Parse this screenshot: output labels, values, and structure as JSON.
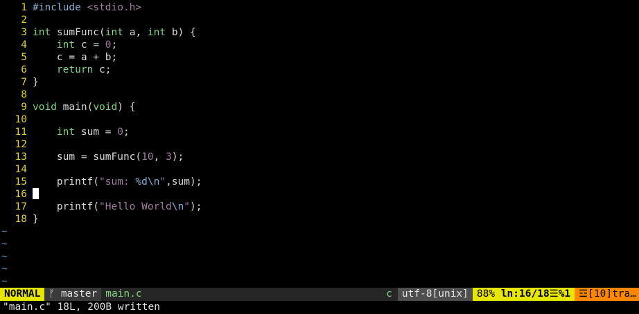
{
  "editor": {
    "lines": [
      {
        "num": "1",
        "tokens": [
          [
            "pre",
            "#include "
          ],
          [
            "str",
            "<stdio.h>"
          ]
        ]
      },
      {
        "num": "2",
        "tokens": []
      },
      {
        "num": "3",
        "tokens": [
          [
            "type",
            "int"
          ],
          [
            "plain",
            " sumFunc("
          ],
          [
            "type",
            "int"
          ],
          [
            "plain",
            " a, "
          ],
          [
            "type",
            "int"
          ],
          [
            "plain",
            " b) {"
          ]
        ]
      },
      {
        "num": "4",
        "tokens": [
          [
            "plain",
            "    "
          ],
          [
            "type",
            "int"
          ],
          [
            "plain",
            " c = "
          ],
          [
            "num",
            "0"
          ],
          [
            "plain",
            ";"
          ]
        ]
      },
      {
        "num": "5",
        "tokens": [
          [
            "plain",
            "    c = a + b;"
          ]
        ]
      },
      {
        "num": "6",
        "tokens": [
          [
            "plain",
            "    "
          ],
          [
            "kw",
            "return"
          ],
          [
            "plain",
            " c;"
          ]
        ]
      },
      {
        "num": "7",
        "tokens": [
          [
            "plain",
            "}"
          ]
        ]
      },
      {
        "num": "8",
        "tokens": []
      },
      {
        "num": "9",
        "tokens": [
          [
            "type",
            "void"
          ],
          [
            "plain",
            " main("
          ],
          [
            "type",
            "void"
          ],
          [
            "plain",
            ") {"
          ]
        ]
      },
      {
        "num": "10",
        "tokens": []
      },
      {
        "num": "11",
        "tokens": [
          [
            "plain",
            "    "
          ],
          [
            "type",
            "int"
          ],
          [
            "plain",
            " sum = "
          ],
          [
            "num",
            "0"
          ],
          [
            "plain",
            ";"
          ]
        ]
      },
      {
        "num": "12",
        "tokens": []
      },
      {
        "num": "13",
        "tokens": [
          [
            "plain",
            "    sum = sumFunc("
          ],
          [
            "num",
            "10"
          ],
          [
            "plain",
            ", "
          ],
          [
            "num",
            "3"
          ],
          [
            "plain",
            ");"
          ]
        ]
      },
      {
        "num": "14",
        "tokens": []
      },
      {
        "num": "15",
        "tokens": [
          [
            "plain",
            "    printf("
          ],
          [
            "str",
            "\"sum: "
          ],
          [
            "pre",
            "%d\\n"
          ],
          [
            "str",
            "\""
          ],
          [
            "plain",
            ",sum);"
          ]
        ]
      },
      {
        "num": "16",
        "tokens": [],
        "cursor": true
      },
      {
        "num": "17",
        "tokens": [
          [
            "plain",
            "    printf("
          ],
          [
            "str",
            "\"Hello World"
          ],
          [
            "pre",
            "\\n"
          ],
          [
            "str",
            "\""
          ],
          [
            "plain",
            ");"
          ]
        ]
      },
      {
        "num": "18",
        "tokens": [
          [
            "plain",
            "}"
          ]
        ]
      }
    ],
    "tilde_count": 5,
    "tilde_char": "~"
  },
  "statusline": {
    "mode": "NORMAL",
    "branch_icon": "ᚠ",
    "branch": "master",
    "filename": "main.c",
    "filetype": "c",
    "encoding": "utf-8[unix]",
    "percent": "88%",
    "position_prefix": "ln",
    "position": ":16/18",
    "column_icon": "☰",
    "column": "%1",
    "warning_icon": "☲",
    "warning": "[10]tra…"
  },
  "cmdline": {
    "message": "\"main.c\" 18L, 200B written"
  },
  "colors": {
    "background": "#000000",
    "line_number": "#e0d030",
    "type_keyword": "#7fd47f",
    "string": "#a07ca0",
    "preprocessor": "#87afd7",
    "mode_bg": "#e6e600",
    "warning_bg": "#ff8700"
  }
}
